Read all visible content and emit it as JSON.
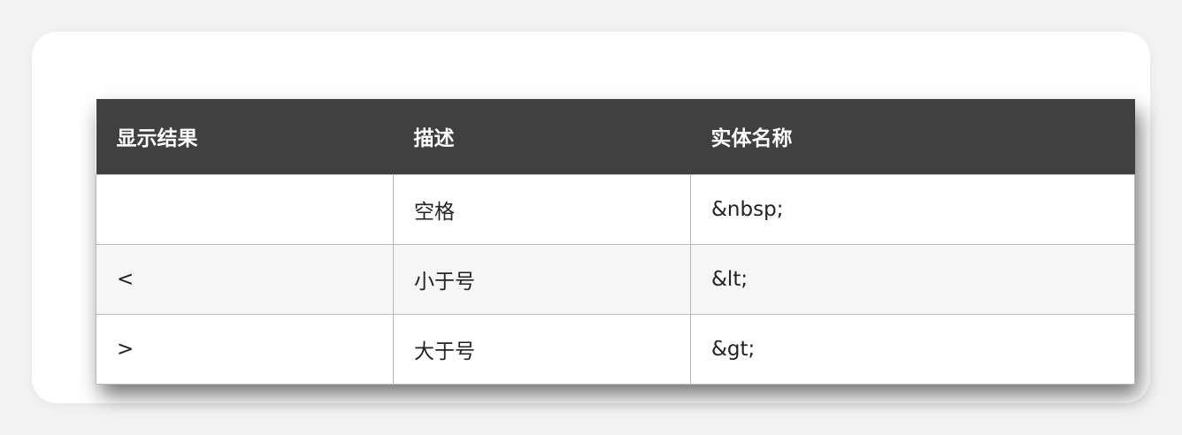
{
  "table": {
    "headers": [
      "显示结果",
      "描述",
      "实体名称"
    ],
    "rows": [
      {
        "result": "",
        "description": "空格",
        "entity": "&nbsp;"
      },
      {
        "result": "<",
        "description": "小于号",
        "entity": "&lt;"
      },
      {
        "result": ">",
        "description": "大于号",
        "entity": "&gt;"
      }
    ]
  }
}
